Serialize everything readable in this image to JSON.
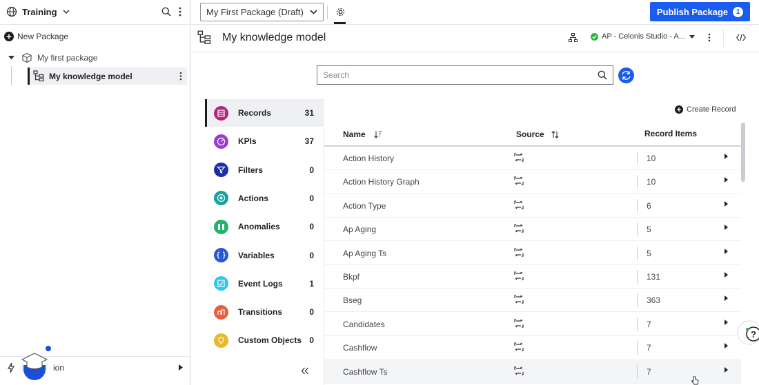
{
  "sidebar": {
    "workspace": "Training",
    "new_package": "New Package",
    "package": "My first package",
    "model": "My knowledge model",
    "bottom_label": "ion"
  },
  "topbar": {
    "package_select": "My First Package (Draft)",
    "publish_label": "Publish Package",
    "publish_badge": "1"
  },
  "header": {
    "title": "My knowledge model",
    "data_model": "AP - Celonis Studio - A..."
  },
  "search": {
    "placeholder": "Search"
  },
  "categories": [
    {
      "label": "Records",
      "count": "31",
      "color": "#b5247a"
    },
    {
      "label": "KPIs",
      "count": "37",
      "color": "#9c3ad6"
    },
    {
      "label": "Filters",
      "count": "0",
      "color": "#1e2ea8"
    },
    {
      "label": "Actions",
      "count": "0",
      "color": "#16a2a2"
    },
    {
      "label": "Anomalies",
      "count": "0",
      "color": "#20b46a"
    },
    {
      "label": "Variables",
      "count": "0",
      "color": "#2a55d8"
    },
    {
      "label": "Event Logs",
      "count": "1",
      "color": "#32c6e8"
    },
    {
      "label": "Transitions",
      "count": "0",
      "color": "#e2613e"
    },
    {
      "label": "Custom Objects",
      "count": "0",
      "color": "#e8b830"
    }
  ],
  "table": {
    "create_label": "Create Record",
    "columns": {
      "name": "Name",
      "source": "Source",
      "items": "Record Items"
    },
    "rows": [
      {
        "name": "Action History",
        "items": "10"
      },
      {
        "name": "Action History Graph",
        "items": "10"
      },
      {
        "name": "Action Type",
        "items": "6"
      },
      {
        "name": "Ap Aging",
        "items": "5"
      },
      {
        "name": "Ap Aging Ts",
        "items": "5"
      },
      {
        "name": "Bkpf",
        "items": "131"
      },
      {
        "name": "Bseg",
        "items": "363"
      },
      {
        "name": "Candidates",
        "items": "7"
      },
      {
        "name": "Cashflow",
        "items": "7"
      },
      {
        "name": "Cashflow Ts",
        "items": "7"
      }
    ]
  },
  "colors": {
    "accent": "#1a5cf0",
    "status_ok": "#2fb344"
  }
}
